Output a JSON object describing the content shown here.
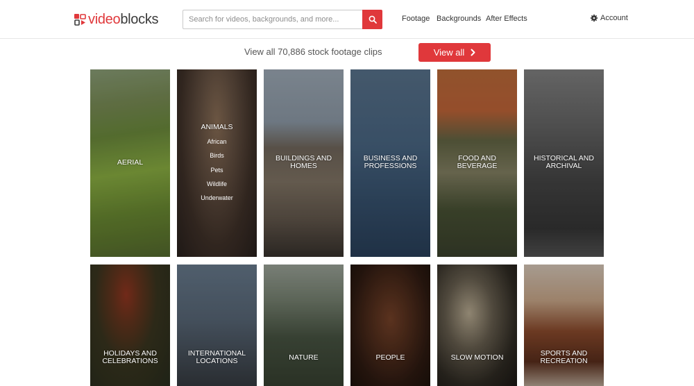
{
  "header": {
    "logo": {
      "part1": "video",
      "part2": "blocks"
    },
    "search": {
      "placeholder": "Search for videos, backgrounds, and more...",
      "value": ""
    },
    "nav": [
      {
        "label": "Footage"
      },
      {
        "label": "Backgrounds"
      },
      {
        "label": "After Effects"
      }
    ],
    "account_label": "Account"
  },
  "subbar": {
    "count_text": "View all 70,886 stock footage clips",
    "view_all_label": "View all"
  },
  "categories": [
    {
      "label": "AERIAL"
    },
    {
      "label": "ANIMALS",
      "subitems": [
        "African",
        "Birds",
        "Pets",
        "Wildlife",
        "Underwater"
      ]
    },
    {
      "label": "BUILDINGS AND HOMES"
    },
    {
      "label": "BUSINESS AND PROFESSIONS"
    },
    {
      "label": "FOOD AND BEVERAGE"
    },
    {
      "label": "HISTORICAL AND ARCHIVAL"
    },
    {
      "label": "HOLIDAYS AND CELEBRATIONS"
    },
    {
      "label": "INTERNATIONAL LOCATIONS"
    },
    {
      "label": "NATURE"
    },
    {
      "label": "PEOPLE"
    },
    {
      "label": "SLOW MOTION"
    },
    {
      "label": "SPORTS AND RECREATION"
    }
  ],
  "colors": {
    "accent": "#e0383b",
    "text": "#333333"
  }
}
